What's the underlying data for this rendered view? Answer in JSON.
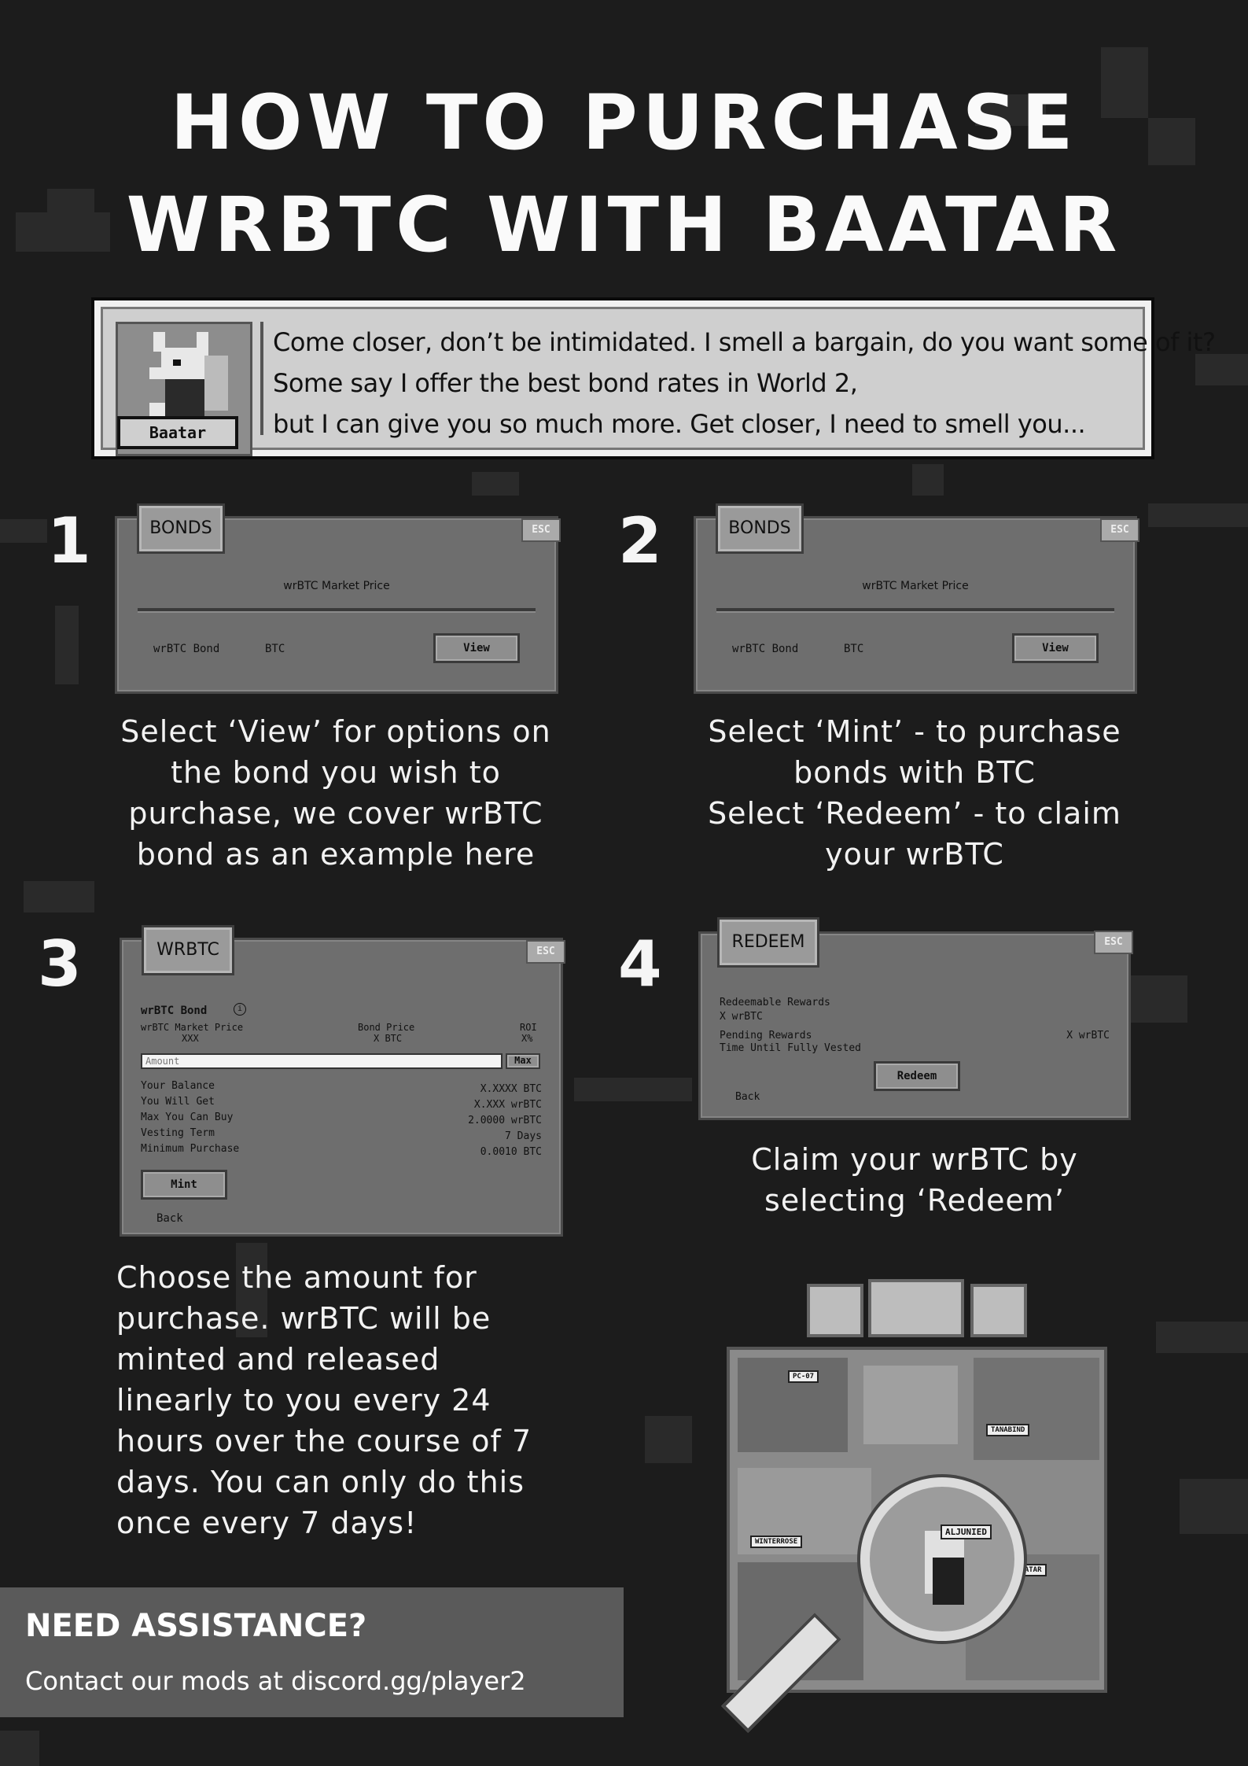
{
  "title": {
    "line1": "HOW TO PURCHASE",
    "line2": "WRBTC WITH BAATAR"
  },
  "dialog": {
    "speaker": "Baatar",
    "lines": [
      "Come closer, don’t be intimidated. I smell a bargain, do you want some of it?",
      "Some say I offer the best bond rates in World 2,",
      "but I can give you so much more. Get closer, I need to smell you..."
    ]
  },
  "steps": [
    {
      "number": "1",
      "tab": "BONDS",
      "esc": "ESC",
      "market_price_label": "wrBTC Market Price",
      "bond_name": "wrBTC Bond",
      "bond_currency": "BTC",
      "view_label": "View",
      "caption": [
        "Select ‘View’ for options on",
        "the bond you wish to",
        "purchase, we cover wrBTC",
        "bond as an example here"
      ]
    },
    {
      "number": "2",
      "tab": "BONDS",
      "esc": "ESC",
      "market_price_label": "wrBTC Market Price",
      "bond_name": "wrBTC Bond",
      "bond_currency": "BTC",
      "view_label": "View",
      "caption": [
        "Select ‘Mint’ - to purchase",
        "bonds with BTC",
        "Select ‘Redeem’ - to claim",
        "your wrBTC"
      ]
    },
    {
      "number": "3",
      "tab": "WRBTC",
      "esc": "ESC",
      "bond_title": "wrBTC Bond",
      "info_icon": "info-circle-icon",
      "market_price_label": "wrBTC Market Price",
      "market_price_value": "XXX",
      "bond_price_label": "Bond Price",
      "bond_price_value": "X BTC",
      "roi_label": "ROI",
      "roi_value": "X%",
      "amount_placeholder": "Amount",
      "max_label": "Max",
      "rows": [
        {
          "label": "Your Balance",
          "value": "X.XXXX BTC"
        },
        {
          "label": "You Will Get",
          "value": "X.XXX wrBTC"
        },
        {
          "label": "Max You Can Buy",
          "value": "2.0000 wrBTC"
        },
        {
          "label": "Vesting Term",
          "value": "7 Days"
        },
        {
          "label": "Minimum Purchase",
          "value": "0.0010 BTC"
        }
      ],
      "mint_label": "Mint",
      "back_label": "Back",
      "caption": [
        "Choose the amount for",
        "purchase. wrBTC will be",
        "minted and released",
        "linearly to you every 24",
        "hours over the course of 7",
        "days. You can only do this",
        "once every 7 days!"
      ]
    },
    {
      "number": "4",
      "tab": "REDEEM",
      "esc": "ESC",
      "redeemable_label": "Redeemable Rewards",
      "redeemable_value": "X wrBTC",
      "pending_label": "Pending Rewards",
      "pending_value": "X wrBTC",
      "time_label": "Time Until Fully Vested",
      "redeem_label": "Redeem",
      "back_label": "Back",
      "caption": [
        "Claim your wrBTC by",
        "selecting ‘Redeem’"
      ]
    }
  ],
  "assistance": {
    "title": "NEED ASSISTANCE?",
    "text": "Contact our mods at discord.gg/player2"
  },
  "map": {
    "labels": [
      "PC-07",
      "TANABIND",
      "WINTERROSE",
      "BAATAR",
      "ALJUNIED"
    ],
    "magnifier_icon": "magnifying-glass-icon"
  },
  "colors": {
    "background": "#1c1c1c",
    "panel": "#6e6e6e",
    "dialog": "#cfcfcf"
  }
}
